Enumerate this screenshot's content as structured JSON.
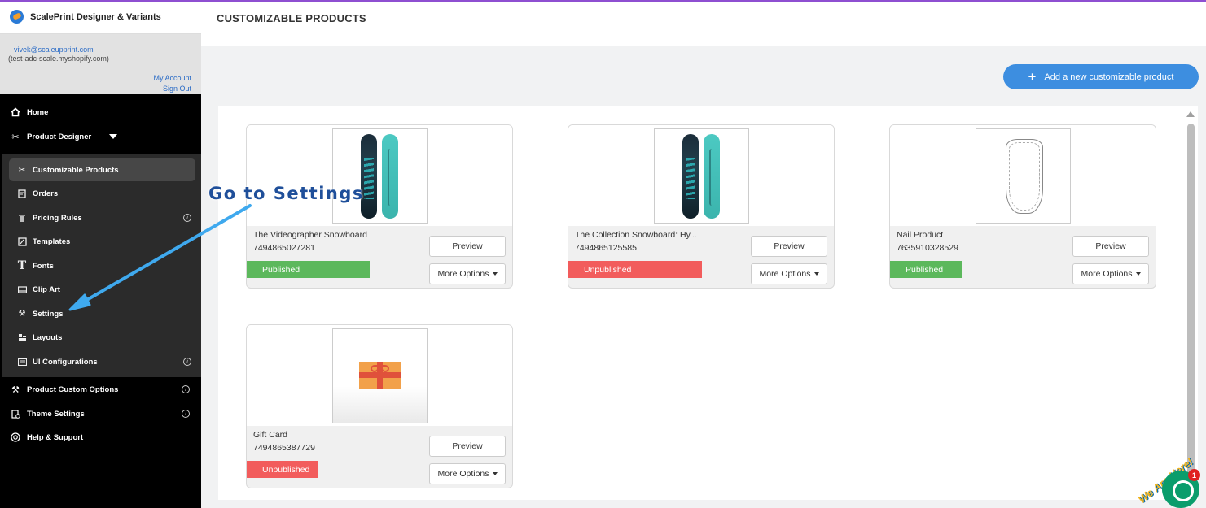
{
  "app": {
    "title": "ScalePrint Designer & Variants"
  },
  "account": {
    "email": "vivek@scaleupprint.com",
    "shop": "(test-adc-scale.myshopify.com)",
    "my_account": "My Account",
    "sign_out": "Sign Out"
  },
  "sidebar": {
    "home": "Home",
    "product_designer": "Product Designer",
    "sub_items": [
      {
        "label": "Customizable Products",
        "icon": "scissors-icon"
      },
      {
        "label": "Orders",
        "icon": "orders-icon"
      },
      {
        "label": "Pricing Rules",
        "icon": "trash-icon"
      },
      {
        "label": "Templates",
        "icon": "template-icon"
      },
      {
        "label": "Fonts",
        "icon": "font-icon"
      },
      {
        "label": "Clip Art",
        "icon": "clipart-icon"
      },
      {
        "label": "Settings",
        "icon": "tools-icon"
      },
      {
        "label": "Layouts",
        "icon": "layout-icon"
      },
      {
        "label": "UI Configurations",
        "icon": "ui-config-icon"
      }
    ],
    "product_custom_options": "Product Custom Options",
    "theme_settings": "Theme Settings",
    "help_support": "Help & Support",
    "info_glyph": "i"
  },
  "header": {
    "title": "CUSTOMIZABLE PRODUCTS"
  },
  "add_button": {
    "label": "Add a new customizable product",
    "plus": "+"
  },
  "products": [
    {
      "name": "The Videographer Snowboard",
      "id": "7494865027281",
      "status": "Published",
      "art": "snowboard"
    },
    {
      "name": "The Collection Snowboard: Hy...",
      "id": "7494865125585",
      "status": "Unpublished",
      "art": "snowboard"
    },
    {
      "name": "Nail Product",
      "id": "7635910328529",
      "status": "Published",
      "art": "nail"
    },
    {
      "name": "Gift Card",
      "id": "7494865387729",
      "status": "Unpublished",
      "art": "gift"
    }
  ],
  "card_buttons": {
    "preview": "Preview",
    "more_options": "More Options"
  },
  "annotation": {
    "text": "Go to Settings",
    "color": "#1f4f9a",
    "arrow_color": "#3fa9ee"
  },
  "chat": {
    "label": "We Are Here!",
    "badge": "1"
  },
  "colors": {
    "published": "#5cb85c",
    "unpublished": "#f25c5c",
    "accent": "#3d8ee0"
  }
}
